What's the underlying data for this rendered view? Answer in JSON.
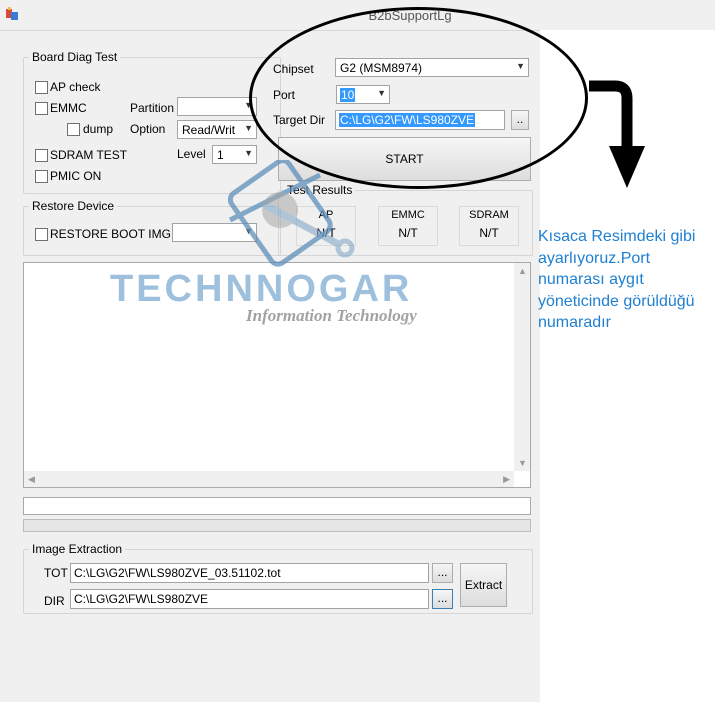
{
  "window": {
    "title": "B2bSupportLg"
  },
  "board_diag": {
    "legend": "Board Diag Test",
    "ap_check": "AP check",
    "emmc": "EMMC",
    "partition_label": "Partition",
    "partition_value": "",
    "dump": "dump",
    "option_label": "Option",
    "option_value": "Read/Writ",
    "sdram_test": "SDRAM TEST",
    "level_label": "Level",
    "level_value": "1",
    "pmic_on": "PMIC ON"
  },
  "connection": {
    "chipset_label": "Chipset",
    "chipset_value": "G2 (MSM8974)",
    "port_label": "Port",
    "port_value": "10",
    "target_dir_label": "Target Dir",
    "target_dir_value": "C:\\LG\\G2\\FW\\LS980ZVE",
    "browse_label": "..",
    "start_label": "START"
  },
  "restore": {
    "legend": "Restore Device",
    "restore_boot_img": "RESTORE BOOT IMG",
    "img_value": ""
  },
  "test_results": {
    "legend": "Test Results",
    "items": [
      {
        "name": "AP",
        "value": "N/T"
      },
      {
        "name": "EMMC",
        "value": "N/T"
      },
      {
        "name": "SDRAM",
        "value": "N/T"
      }
    ]
  },
  "image_extraction": {
    "legend": "Image Extraction",
    "tot_label": "TOT",
    "tot_value": "C:\\LG\\G2\\FW\\LS980ZVE_03.51102.tot",
    "dir_label": "DIR",
    "dir_value": "C:\\LG\\G2\\FW\\LS980ZVE",
    "browse1": "...",
    "browse2": "...",
    "extract_label": "Extract"
  },
  "watermark": {
    "brand": "TECHNNOGAR",
    "tagline": "Information Technology"
  },
  "annotation": {
    "text": "Kısaca Resimdeki gibi ayarlıyoruz.Port numarası aygıt yöneticinde görüldüğü numaradır"
  },
  "colors": {
    "selection": "#3399ff",
    "annotation_text": "#1f7fd1"
  }
}
